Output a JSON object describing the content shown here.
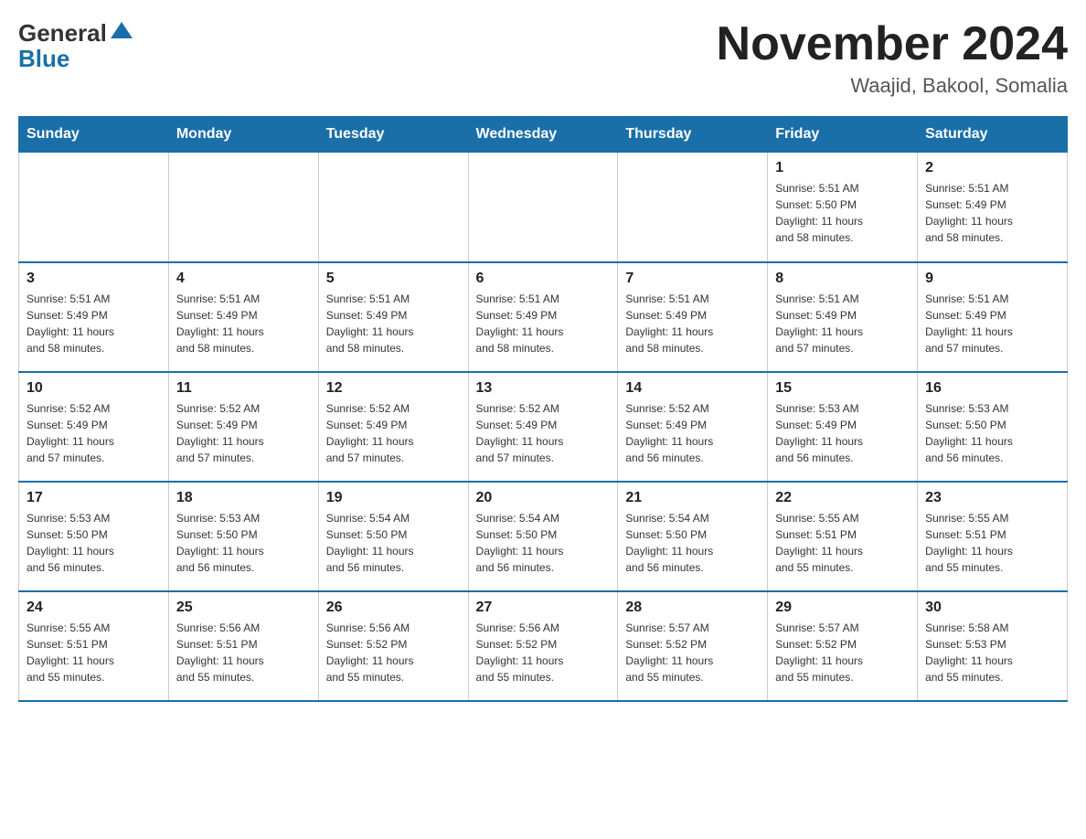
{
  "logo": {
    "general": "General",
    "blue": "Blue"
  },
  "title": "November 2024",
  "subtitle": "Waajid, Bakool, Somalia",
  "days_header": [
    "Sunday",
    "Monday",
    "Tuesday",
    "Wednesday",
    "Thursday",
    "Friday",
    "Saturday"
  ],
  "weeks": [
    [
      {
        "day": "",
        "info": ""
      },
      {
        "day": "",
        "info": ""
      },
      {
        "day": "",
        "info": ""
      },
      {
        "day": "",
        "info": ""
      },
      {
        "day": "",
        "info": ""
      },
      {
        "day": "1",
        "info": "Sunrise: 5:51 AM\nSunset: 5:50 PM\nDaylight: 11 hours\nand 58 minutes."
      },
      {
        "day": "2",
        "info": "Sunrise: 5:51 AM\nSunset: 5:49 PM\nDaylight: 11 hours\nand 58 minutes."
      }
    ],
    [
      {
        "day": "3",
        "info": "Sunrise: 5:51 AM\nSunset: 5:49 PM\nDaylight: 11 hours\nand 58 minutes."
      },
      {
        "day": "4",
        "info": "Sunrise: 5:51 AM\nSunset: 5:49 PM\nDaylight: 11 hours\nand 58 minutes."
      },
      {
        "day": "5",
        "info": "Sunrise: 5:51 AM\nSunset: 5:49 PM\nDaylight: 11 hours\nand 58 minutes."
      },
      {
        "day": "6",
        "info": "Sunrise: 5:51 AM\nSunset: 5:49 PM\nDaylight: 11 hours\nand 58 minutes."
      },
      {
        "day": "7",
        "info": "Sunrise: 5:51 AM\nSunset: 5:49 PM\nDaylight: 11 hours\nand 58 minutes."
      },
      {
        "day": "8",
        "info": "Sunrise: 5:51 AM\nSunset: 5:49 PM\nDaylight: 11 hours\nand 57 minutes."
      },
      {
        "day": "9",
        "info": "Sunrise: 5:51 AM\nSunset: 5:49 PM\nDaylight: 11 hours\nand 57 minutes."
      }
    ],
    [
      {
        "day": "10",
        "info": "Sunrise: 5:52 AM\nSunset: 5:49 PM\nDaylight: 11 hours\nand 57 minutes."
      },
      {
        "day": "11",
        "info": "Sunrise: 5:52 AM\nSunset: 5:49 PM\nDaylight: 11 hours\nand 57 minutes."
      },
      {
        "day": "12",
        "info": "Sunrise: 5:52 AM\nSunset: 5:49 PM\nDaylight: 11 hours\nand 57 minutes."
      },
      {
        "day": "13",
        "info": "Sunrise: 5:52 AM\nSunset: 5:49 PM\nDaylight: 11 hours\nand 57 minutes."
      },
      {
        "day": "14",
        "info": "Sunrise: 5:52 AM\nSunset: 5:49 PM\nDaylight: 11 hours\nand 56 minutes."
      },
      {
        "day": "15",
        "info": "Sunrise: 5:53 AM\nSunset: 5:49 PM\nDaylight: 11 hours\nand 56 minutes."
      },
      {
        "day": "16",
        "info": "Sunrise: 5:53 AM\nSunset: 5:50 PM\nDaylight: 11 hours\nand 56 minutes."
      }
    ],
    [
      {
        "day": "17",
        "info": "Sunrise: 5:53 AM\nSunset: 5:50 PM\nDaylight: 11 hours\nand 56 minutes."
      },
      {
        "day": "18",
        "info": "Sunrise: 5:53 AM\nSunset: 5:50 PM\nDaylight: 11 hours\nand 56 minutes."
      },
      {
        "day": "19",
        "info": "Sunrise: 5:54 AM\nSunset: 5:50 PM\nDaylight: 11 hours\nand 56 minutes."
      },
      {
        "day": "20",
        "info": "Sunrise: 5:54 AM\nSunset: 5:50 PM\nDaylight: 11 hours\nand 56 minutes."
      },
      {
        "day": "21",
        "info": "Sunrise: 5:54 AM\nSunset: 5:50 PM\nDaylight: 11 hours\nand 56 minutes."
      },
      {
        "day": "22",
        "info": "Sunrise: 5:55 AM\nSunset: 5:51 PM\nDaylight: 11 hours\nand 55 minutes."
      },
      {
        "day": "23",
        "info": "Sunrise: 5:55 AM\nSunset: 5:51 PM\nDaylight: 11 hours\nand 55 minutes."
      }
    ],
    [
      {
        "day": "24",
        "info": "Sunrise: 5:55 AM\nSunset: 5:51 PM\nDaylight: 11 hours\nand 55 minutes."
      },
      {
        "day": "25",
        "info": "Sunrise: 5:56 AM\nSunset: 5:51 PM\nDaylight: 11 hours\nand 55 minutes."
      },
      {
        "day": "26",
        "info": "Sunrise: 5:56 AM\nSunset: 5:52 PM\nDaylight: 11 hours\nand 55 minutes."
      },
      {
        "day": "27",
        "info": "Sunrise: 5:56 AM\nSunset: 5:52 PM\nDaylight: 11 hours\nand 55 minutes."
      },
      {
        "day": "28",
        "info": "Sunrise: 5:57 AM\nSunset: 5:52 PM\nDaylight: 11 hours\nand 55 minutes."
      },
      {
        "day": "29",
        "info": "Sunrise: 5:57 AM\nSunset: 5:52 PM\nDaylight: 11 hours\nand 55 minutes."
      },
      {
        "day": "30",
        "info": "Sunrise: 5:58 AM\nSunset: 5:53 PM\nDaylight: 11 hours\nand 55 minutes."
      }
    ]
  ]
}
